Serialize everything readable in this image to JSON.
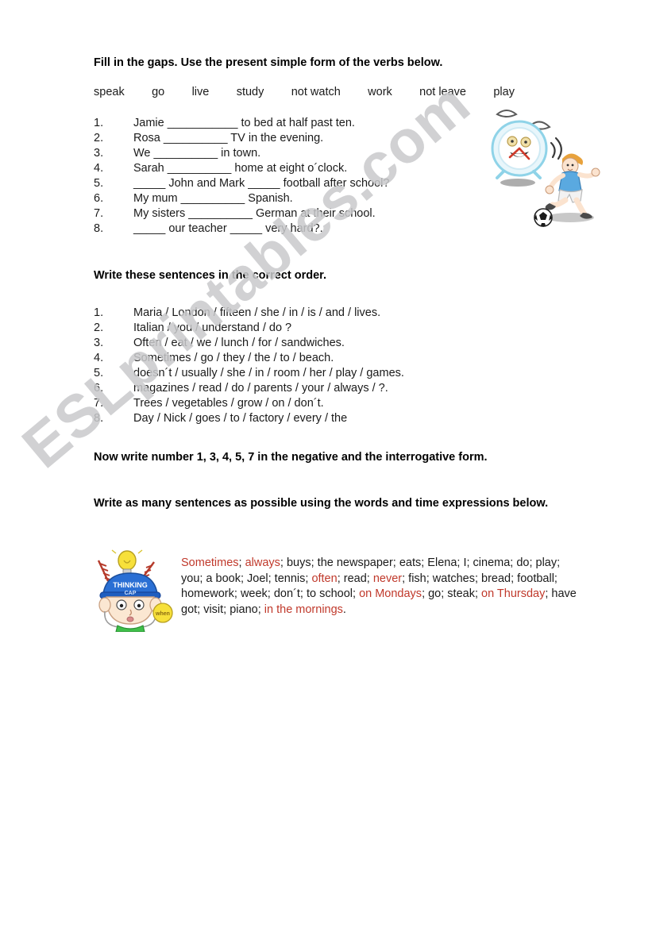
{
  "watermark": {
    "text": "ESLprintables.com"
  },
  "exercise1": {
    "heading": "Fill in the gaps. Use the present simple form of the verbs below.",
    "verbs": [
      "speak",
      "go",
      "live",
      "study",
      "not watch",
      "work",
      "not leave",
      "play"
    ],
    "items": [
      {
        "num": "1.",
        "text": "Jamie ___________ to bed at half past ten."
      },
      {
        "num": "2.",
        "text": "Rosa __________ TV in the evening."
      },
      {
        "num": "3.",
        "text": "We __________ in town."
      },
      {
        "num": "4.",
        "text": "Sarah __________ home at eight o´clock."
      },
      {
        "num": "5.",
        "text": "_____ John and Mark _____ football after school?"
      },
      {
        "num": "6.",
        "text": "My mum __________ Spanish."
      },
      {
        "num": "7.",
        "text": "My sisters __________ German at their school."
      },
      {
        "num": "8.",
        "text": "_____ our teacher _____ very hard?."
      }
    ]
  },
  "exercise2": {
    "heading": "Write these sentences in the correct order.",
    "items": [
      {
        "num": "1.",
        "text": "Maria / London / fifteen / she / in / is / and / lives."
      },
      {
        "num": "2.",
        "text": "Italian / you / understand / do ?"
      },
      {
        "num": "3.",
        "text": "Often / eat / we / lunch / for / sandwiches."
      },
      {
        "num": "4.",
        "text": "Sometimes / go / they / the / to / beach."
      },
      {
        "num": "5.",
        "text": "doesn´t / usually / she / in / room / her / play / games."
      },
      {
        "num": "6.",
        "text": "magazines / read / do / parents / your / always / ?."
      },
      {
        "num": "7.",
        "text": "Trees / vegetables / grow / on / don´t."
      },
      {
        "num": "8.",
        "text": "Day / Nick / goes / to / factory / every / the"
      }
    ]
  },
  "exercise3": {
    "heading": "Now write number 1, 3, 4, 5, 7 in the negative and the interrogative form."
  },
  "exercise4": {
    "heading": "Write as many sentences as possible using the words and time expressions below.",
    "word_pool": [
      {
        "t": "Sometimes",
        "hl": true
      },
      {
        "t": "; "
      },
      {
        "t": "always",
        "hl": true
      },
      {
        "t": "; buys; the newspaper; eats; Elena; I; cinema; do; play; you; a book; Joel; tennis; "
      },
      {
        "t": "often",
        "hl": true
      },
      {
        "t": "; read; "
      },
      {
        "t": "never",
        "hl": true
      },
      {
        "t": "; fish; watches; bread; football; homework; week; don´t; to school; "
      },
      {
        "t": "on Mondays",
        "hl": true
      },
      {
        "t": "; go; steak; "
      },
      {
        "t": "on Thursday",
        "hl": true
      },
      {
        "t": "; have got; visit; piano; "
      },
      {
        "t": "in the mornings",
        "hl": true
      },
      {
        "t": "."
      }
    ],
    "highlight_color": "#c0392b"
  },
  "clipart": {
    "alarm_clock_label": "alarm-clock-smiling",
    "footballer_label": "boy-kicking-football",
    "thinking_cap_label": "boy-with-thinking-cap",
    "thinking_cap_text": "THINKING CAP",
    "thinking_bubble_text": "when"
  }
}
